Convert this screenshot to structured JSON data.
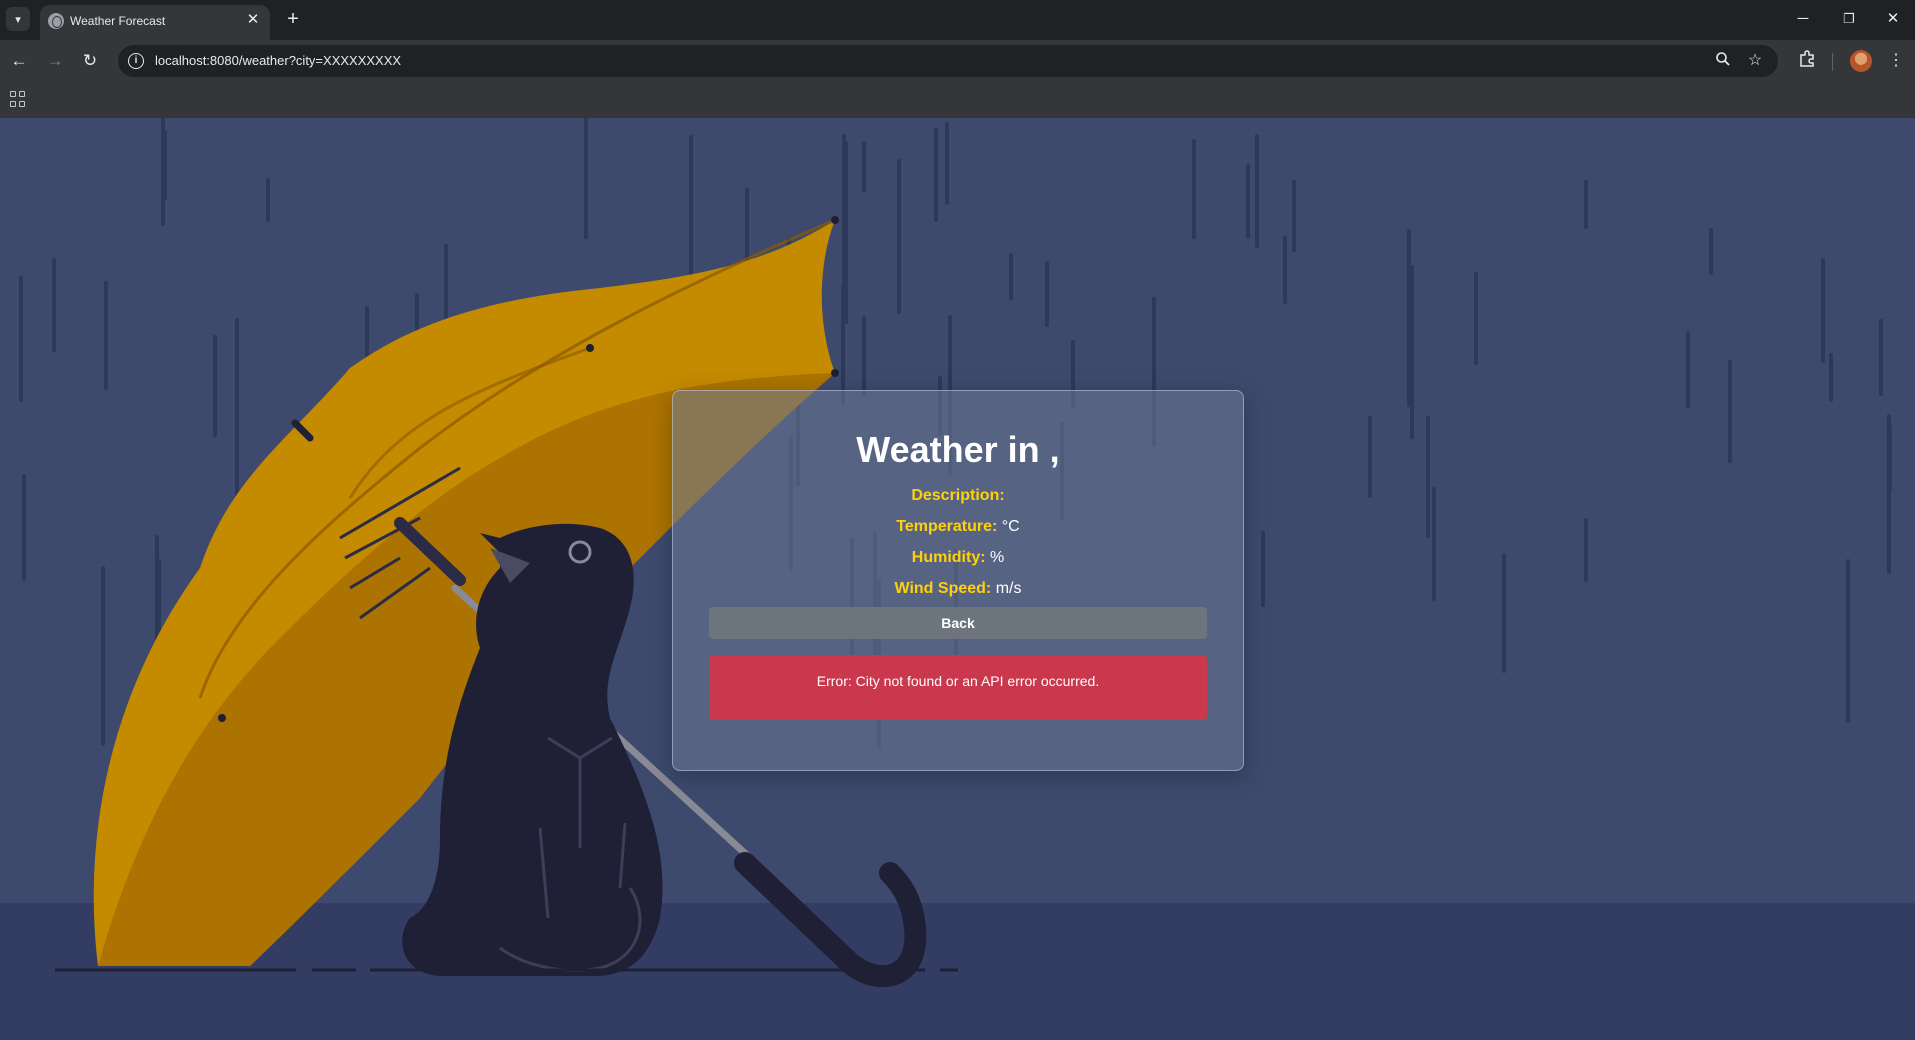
{
  "browser": {
    "tab_title": "Weather Forecast",
    "tab_close": "✕",
    "new_tab": "+",
    "url": "localhost:8080/weather?city=XXXXXXXXX",
    "window_controls": {
      "minimize": "─",
      "restore": "❐",
      "close": "✕"
    }
  },
  "page": {
    "title": "Weather in ,",
    "fields": [
      {
        "label": "Description:",
        "value": ""
      },
      {
        "label": "Temperature:",
        "value": "°C"
      },
      {
        "label": "Humidity:",
        "value": "%"
      },
      {
        "label": "Wind Speed:",
        "value": "m/s"
      }
    ],
    "back_label": "Back",
    "error": "Error: City not found or an API error occurred."
  },
  "icons": [
    "tab-search-icon",
    "globe-icon",
    "back-icon",
    "forward-icon",
    "reload-icon",
    "site-info-icon",
    "zoom-icon",
    "star-icon",
    "extensions-icon",
    "profile-avatar",
    "menu-icon",
    "apps-icon"
  ],
  "colors": {
    "background": "#3d4a6d",
    "label_accent": "#ffd10a",
    "back_button": "#6c757d",
    "error": "#c9384c",
    "umbrella": "#c48a00"
  }
}
